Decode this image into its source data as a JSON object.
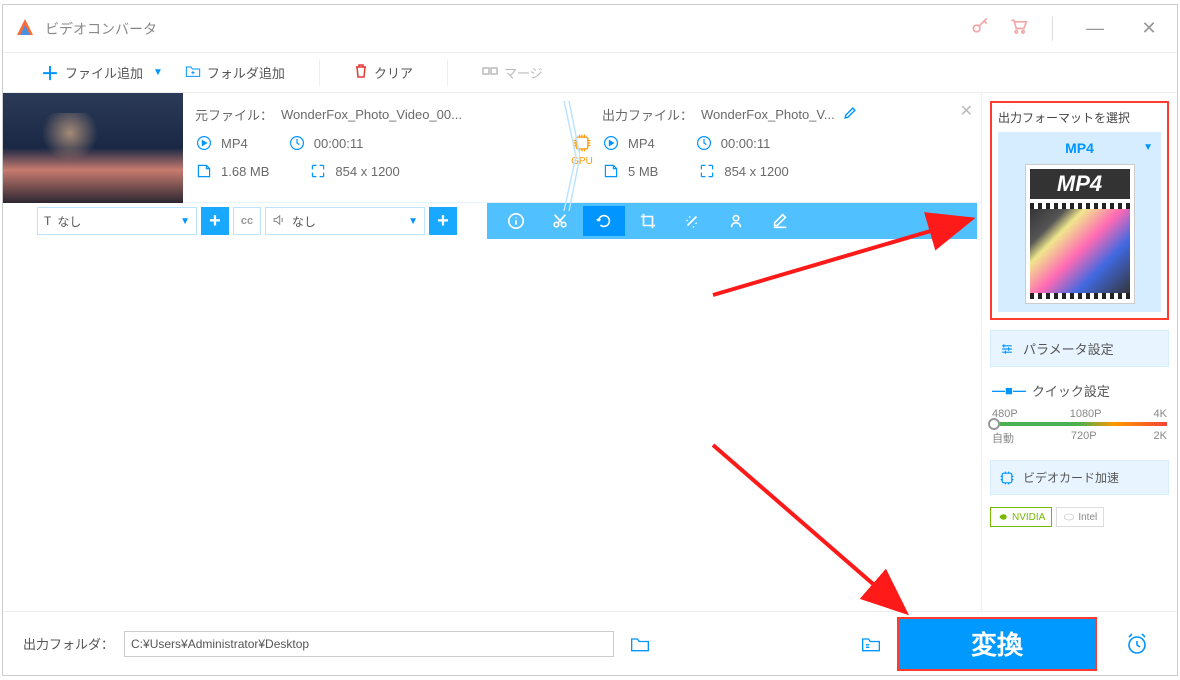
{
  "title": "ビデオコンバータ",
  "toolbar": {
    "add_file": "ファイル追加",
    "add_folder": "フォルダ追加",
    "clear": "クリア",
    "merge": "マージ"
  },
  "file": {
    "source_label": "元ファイル：",
    "source_name": "WonderFox_Photo_Video_00...",
    "output_label": "出力ファイル：",
    "output_name": "WonderFox_Photo_V...",
    "src_format": "MP4",
    "src_duration": "00:00:11",
    "src_size": "1.68 MB",
    "src_res": "854 x 1200",
    "out_format": "MP4",
    "out_duration": "00:00:11",
    "out_size": "5 MB",
    "out_res": "854 x 1200",
    "gpu_label": "GPU"
  },
  "subbar": {
    "subtitle_none": "なし",
    "audio_none": "なし"
  },
  "right": {
    "format_title": "出力フォーマットを選択",
    "format_selected": "MP4",
    "format_badge": "MP4",
    "param_settings": "パラメータ設定",
    "quick_settings": "クイック設定",
    "q480": "480P",
    "q1080": "1080P",
    "q4k": "4K",
    "qauto": "自動",
    "q720": "720P",
    "q2k": "2K",
    "gpu_accel": "ビデオカード加速",
    "nvidia": "NVIDIA",
    "intel": "Intel"
  },
  "bottom": {
    "out_folder_label": "出力フォルダ：",
    "out_folder_path": "C:¥Users¥Administrator¥Desktop",
    "convert": "変換"
  }
}
